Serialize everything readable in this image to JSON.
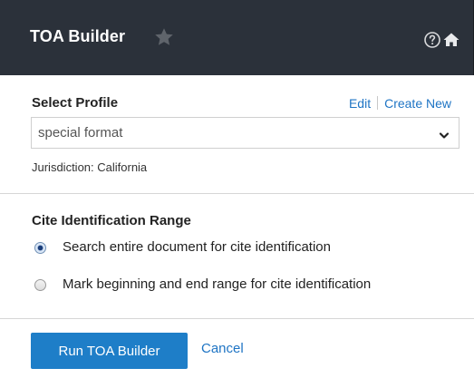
{
  "header": {
    "title": "TOA Builder",
    "favorite_icon": "star-icon",
    "help_icon": "help-circle-icon",
    "home_icon": "home-icon"
  },
  "profile": {
    "label": "Select Profile",
    "edit_label": "Edit",
    "create_new_label": "Create New",
    "selected_value": "special format",
    "jurisdiction": "Jurisdiction: California"
  },
  "range": {
    "label": "Cite Identification Range",
    "options": [
      {
        "label": "Search entire document for cite identification",
        "selected": true
      },
      {
        "label": "Mark beginning and end range for cite identification",
        "selected": false
      }
    ]
  },
  "actions": {
    "run_label": "Run TOA Builder",
    "cancel_label": "Cancel"
  },
  "colors": {
    "header_bg": "#2b313a",
    "accent": "#1e7ec8",
    "link": "#1e74c4"
  }
}
